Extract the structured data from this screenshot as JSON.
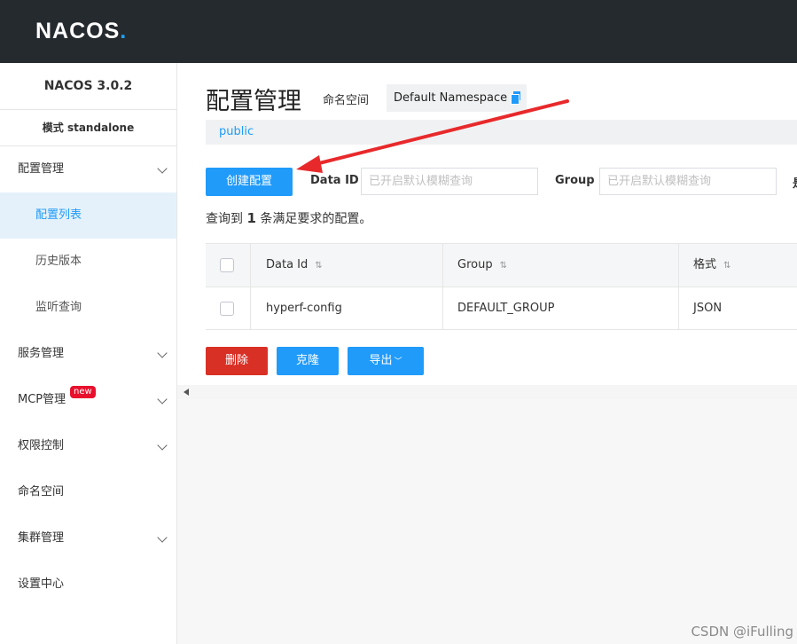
{
  "header": {
    "logo": "NACOS",
    "logo_dot": "."
  },
  "sidebar": {
    "version": "NACOS 3.0.2",
    "mode": "模式 standalone",
    "items": [
      {
        "label": "配置管理",
        "expandable": true
      },
      {
        "label": "配置列表",
        "active": true
      },
      {
        "label": "历史版本"
      },
      {
        "label": "监听查询"
      },
      {
        "label": "服务管理",
        "expandable": true
      },
      {
        "label": "MCP管理",
        "expandable": true,
        "badge": "new"
      },
      {
        "label": "权限控制",
        "expandable": true
      },
      {
        "label": "命名空间"
      },
      {
        "label": "集群管理",
        "expandable": true
      },
      {
        "label": "设置中心"
      }
    ]
  },
  "main": {
    "title": "配置管理",
    "namespace_label": "命名空间",
    "namespace_value": "Default Namespace",
    "namespace_tab": "public",
    "create_button": "创建配置",
    "filters": {
      "data_id_label": "Data ID",
      "data_id_placeholder": "已开启默认模糊查询",
      "group_label": "Group",
      "group_placeholder": "已开启默认模糊查询",
      "cut_label": "是"
    },
    "result": {
      "prefix": "查询到",
      "count": "1",
      "suffix": "条满足要求的配置。"
    },
    "table": {
      "columns": [
        "Data Id",
        "Group",
        "格式"
      ],
      "rows": [
        {
          "data_id": "hyperf-config",
          "group": "DEFAULT_GROUP",
          "format": "JSON"
        }
      ]
    },
    "actions": {
      "delete": "删除",
      "clone": "克隆",
      "export": "导出"
    }
  },
  "colors": {
    "primary": "#209bfa",
    "danger": "#d93026",
    "header_bg": "#252a2f",
    "annotation_arrow": "#e8292b"
  },
  "watermark": "CSDN @iFulling"
}
